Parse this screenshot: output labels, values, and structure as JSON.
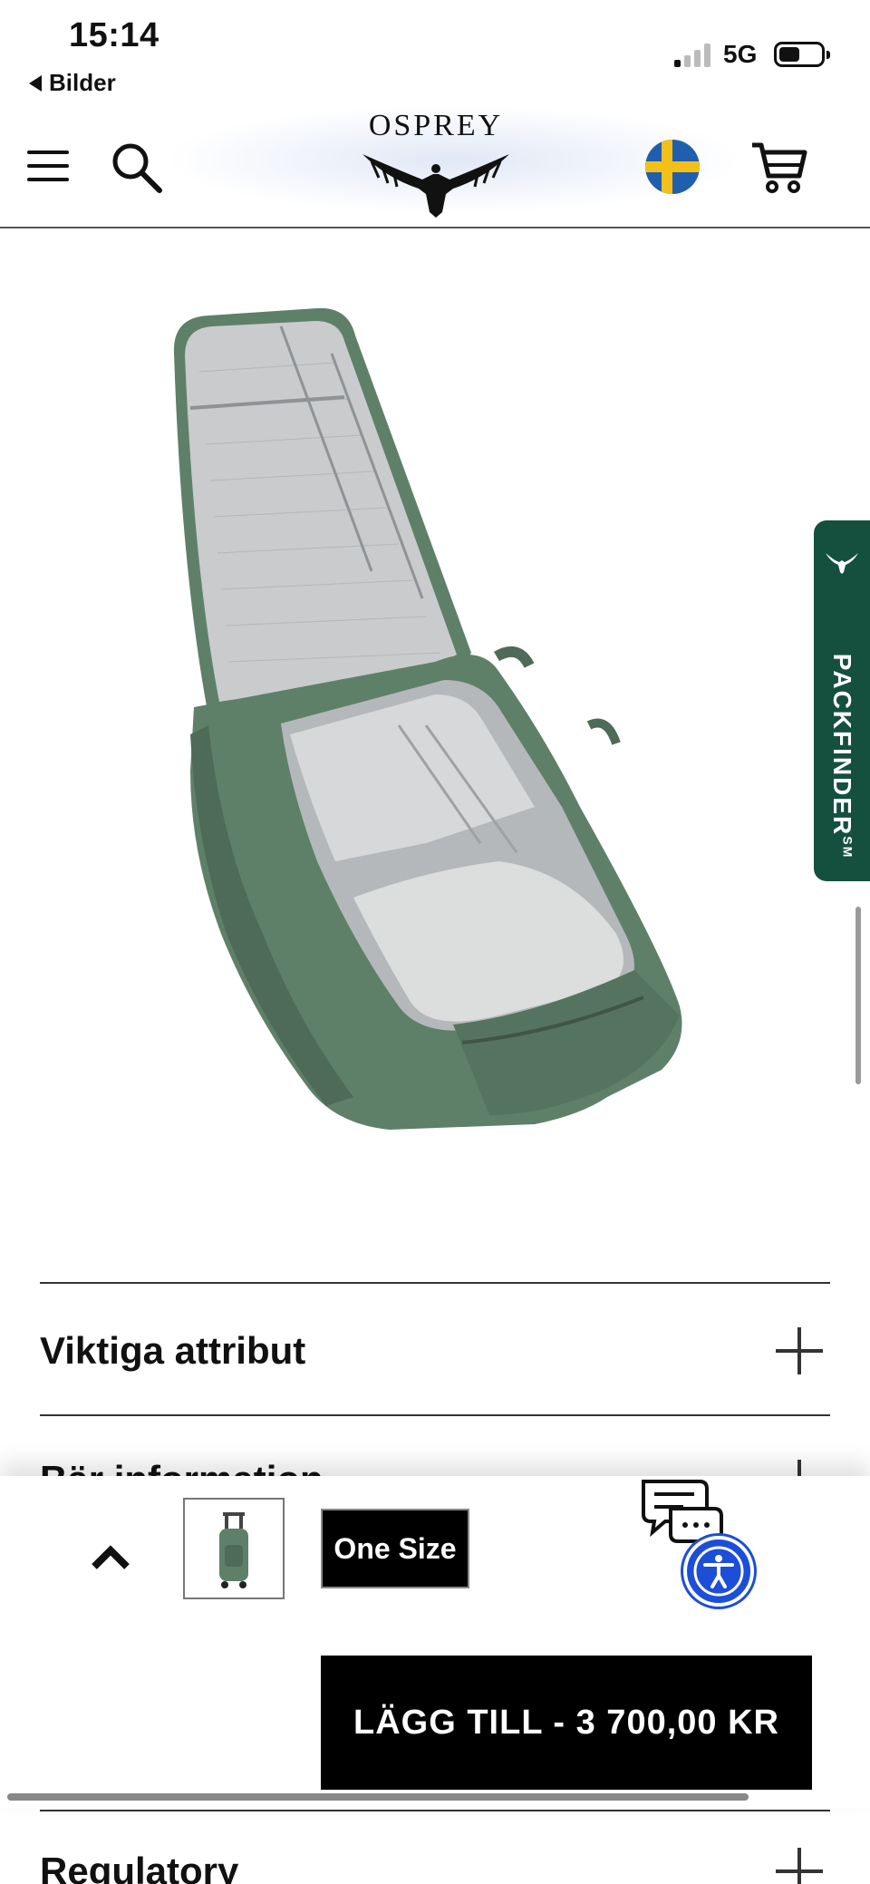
{
  "status_bar": {
    "time": "15:14",
    "back_app": "Bilder",
    "network": "5G"
  },
  "header": {
    "brand": "OSPREY",
    "flag_colors": [
      "#1f5fae",
      "#f3c019"
    ]
  },
  "packfinder": {
    "label": "PACKFINDER",
    "mark": "SM",
    "color": "#15503e"
  },
  "accordion": [
    {
      "title": "Viktiga attribut"
    },
    {
      "title": "Bär information"
    },
    {
      "title": "Regulatory"
    }
  ],
  "sticky_bar": {
    "size_label": "One Size",
    "add_to_cart_label": "LÄGG TILL - 3 700,00 KR"
  },
  "colors": {
    "bag_green": "#5f8068",
    "accessibility_blue": "#1d4ed8"
  }
}
